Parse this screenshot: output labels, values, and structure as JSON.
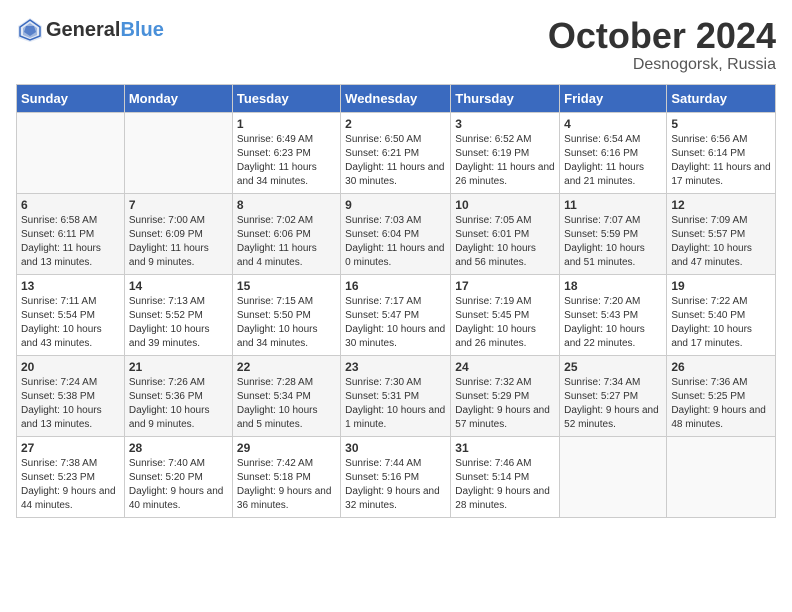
{
  "logo": {
    "general": "General",
    "blue": "Blue"
  },
  "header": {
    "month": "October 2024",
    "location": "Desnogorsk, Russia"
  },
  "columns": [
    "Sunday",
    "Monday",
    "Tuesday",
    "Wednesday",
    "Thursday",
    "Friday",
    "Saturday"
  ],
  "weeks": [
    [
      {
        "day": "",
        "sunrise": "",
        "sunset": "",
        "daylight": ""
      },
      {
        "day": "",
        "sunrise": "",
        "sunset": "",
        "daylight": ""
      },
      {
        "day": "1",
        "sunrise": "Sunrise: 6:49 AM",
        "sunset": "Sunset: 6:23 PM",
        "daylight": "Daylight: 11 hours and 34 minutes."
      },
      {
        "day": "2",
        "sunrise": "Sunrise: 6:50 AM",
        "sunset": "Sunset: 6:21 PM",
        "daylight": "Daylight: 11 hours and 30 minutes."
      },
      {
        "day": "3",
        "sunrise": "Sunrise: 6:52 AM",
        "sunset": "Sunset: 6:19 PM",
        "daylight": "Daylight: 11 hours and 26 minutes."
      },
      {
        "day": "4",
        "sunrise": "Sunrise: 6:54 AM",
        "sunset": "Sunset: 6:16 PM",
        "daylight": "Daylight: 11 hours and 21 minutes."
      },
      {
        "day": "5",
        "sunrise": "Sunrise: 6:56 AM",
        "sunset": "Sunset: 6:14 PM",
        "daylight": "Daylight: 11 hours and 17 minutes."
      }
    ],
    [
      {
        "day": "6",
        "sunrise": "Sunrise: 6:58 AM",
        "sunset": "Sunset: 6:11 PM",
        "daylight": "Daylight: 11 hours and 13 minutes."
      },
      {
        "day": "7",
        "sunrise": "Sunrise: 7:00 AM",
        "sunset": "Sunset: 6:09 PM",
        "daylight": "Daylight: 11 hours and 9 minutes."
      },
      {
        "day": "8",
        "sunrise": "Sunrise: 7:02 AM",
        "sunset": "Sunset: 6:06 PM",
        "daylight": "Daylight: 11 hours and 4 minutes."
      },
      {
        "day": "9",
        "sunrise": "Sunrise: 7:03 AM",
        "sunset": "Sunset: 6:04 PM",
        "daylight": "Daylight: 11 hours and 0 minutes."
      },
      {
        "day": "10",
        "sunrise": "Sunrise: 7:05 AM",
        "sunset": "Sunset: 6:01 PM",
        "daylight": "Daylight: 10 hours and 56 minutes."
      },
      {
        "day": "11",
        "sunrise": "Sunrise: 7:07 AM",
        "sunset": "Sunset: 5:59 PM",
        "daylight": "Daylight: 10 hours and 51 minutes."
      },
      {
        "day": "12",
        "sunrise": "Sunrise: 7:09 AM",
        "sunset": "Sunset: 5:57 PM",
        "daylight": "Daylight: 10 hours and 47 minutes."
      }
    ],
    [
      {
        "day": "13",
        "sunrise": "Sunrise: 7:11 AM",
        "sunset": "Sunset: 5:54 PM",
        "daylight": "Daylight: 10 hours and 43 minutes."
      },
      {
        "day": "14",
        "sunrise": "Sunrise: 7:13 AM",
        "sunset": "Sunset: 5:52 PM",
        "daylight": "Daylight: 10 hours and 39 minutes."
      },
      {
        "day": "15",
        "sunrise": "Sunrise: 7:15 AM",
        "sunset": "Sunset: 5:50 PM",
        "daylight": "Daylight: 10 hours and 34 minutes."
      },
      {
        "day": "16",
        "sunrise": "Sunrise: 7:17 AM",
        "sunset": "Sunset: 5:47 PM",
        "daylight": "Daylight: 10 hours and 30 minutes."
      },
      {
        "day": "17",
        "sunrise": "Sunrise: 7:19 AM",
        "sunset": "Sunset: 5:45 PM",
        "daylight": "Daylight: 10 hours and 26 minutes."
      },
      {
        "day": "18",
        "sunrise": "Sunrise: 7:20 AM",
        "sunset": "Sunset: 5:43 PM",
        "daylight": "Daylight: 10 hours and 22 minutes."
      },
      {
        "day": "19",
        "sunrise": "Sunrise: 7:22 AM",
        "sunset": "Sunset: 5:40 PM",
        "daylight": "Daylight: 10 hours and 17 minutes."
      }
    ],
    [
      {
        "day": "20",
        "sunrise": "Sunrise: 7:24 AM",
        "sunset": "Sunset: 5:38 PM",
        "daylight": "Daylight: 10 hours and 13 minutes."
      },
      {
        "day": "21",
        "sunrise": "Sunrise: 7:26 AM",
        "sunset": "Sunset: 5:36 PM",
        "daylight": "Daylight: 10 hours and 9 minutes."
      },
      {
        "day": "22",
        "sunrise": "Sunrise: 7:28 AM",
        "sunset": "Sunset: 5:34 PM",
        "daylight": "Daylight: 10 hours and 5 minutes."
      },
      {
        "day": "23",
        "sunrise": "Sunrise: 7:30 AM",
        "sunset": "Sunset: 5:31 PM",
        "daylight": "Daylight: 10 hours and 1 minute."
      },
      {
        "day": "24",
        "sunrise": "Sunrise: 7:32 AM",
        "sunset": "Sunset: 5:29 PM",
        "daylight": "Daylight: 9 hours and 57 minutes."
      },
      {
        "day": "25",
        "sunrise": "Sunrise: 7:34 AM",
        "sunset": "Sunset: 5:27 PM",
        "daylight": "Daylight: 9 hours and 52 minutes."
      },
      {
        "day": "26",
        "sunrise": "Sunrise: 7:36 AM",
        "sunset": "Sunset: 5:25 PM",
        "daylight": "Daylight: 9 hours and 48 minutes."
      }
    ],
    [
      {
        "day": "27",
        "sunrise": "Sunrise: 7:38 AM",
        "sunset": "Sunset: 5:23 PM",
        "daylight": "Daylight: 9 hours and 44 minutes."
      },
      {
        "day": "28",
        "sunrise": "Sunrise: 7:40 AM",
        "sunset": "Sunset: 5:20 PM",
        "daylight": "Daylight: 9 hours and 40 minutes."
      },
      {
        "day": "29",
        "sunrise": "Sunrise: 7:42 AM",
        "sunset": "Sunset: 5:18 PM",
        "daylight": "Daylight: 9 hours and 36 minutes."
      },
      {
        "day": "30",
        "sunrise": "Sunrise: 7:44 AM",
        "sunset": "Sunset: 5:16 PM",
        "daylight": "Daylight: 9 hours and 32 minutes."
      },
      {
        "day": "31",
        "sunrise": "Sunrise: 7:46 AM",
        "sunset": "Sunset: 5:14 PM",
        "daylight": "Daylight: 9 hours and 28 minutes."
      },
      {
        "day": "",
        "sunrise": "",
        "sunset": "",
        "daylight": ""
      },
      {
        "day": "",
        "sunrise": "",
        "sunset": "",
        "daylight": ""
      }
    ]
  ]
}
